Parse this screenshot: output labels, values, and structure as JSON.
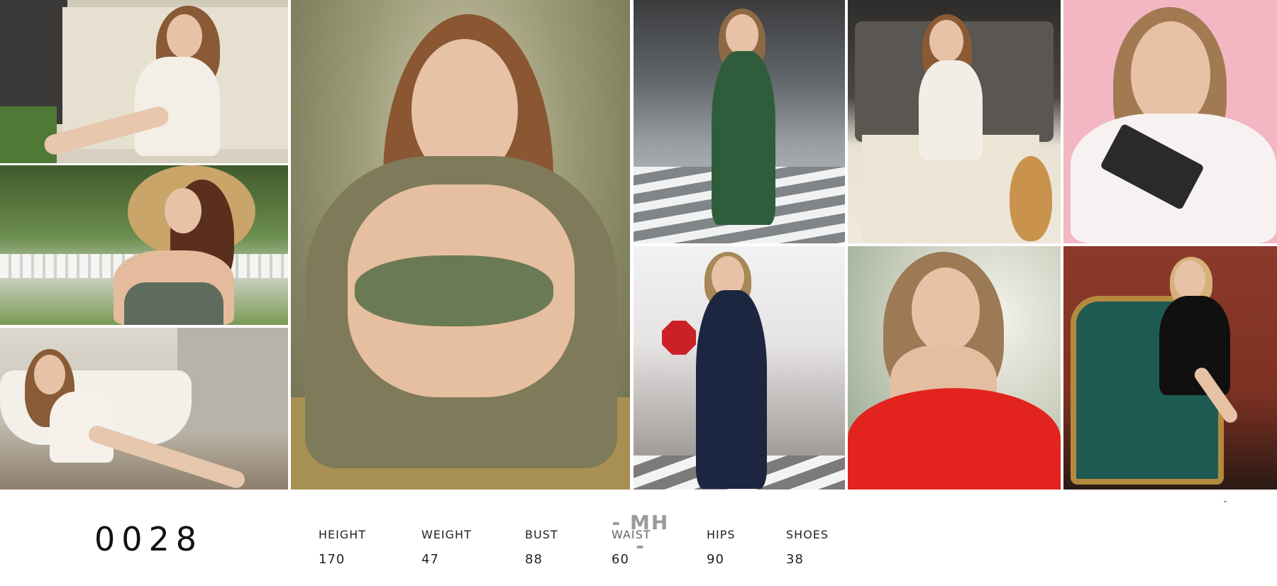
{
  "brand_mark": "- MH -",
  "model_id": "0028",
  "stats": [
    {
      "label": "HEIGHT",
      "value": "170"
    },
    {
      "label": "WEIGHT",
      "value": "47"
    },
    {
      "label": "BUST",
      "value": "88"
    },
    {
      "label": "WAIST",
      "value": "60"
    },
    {
      "label": "HIPS",
      "value": "90"
    },
    {
      "label": "SHOES",
      "value": "38"
    }
  ],
  "photos": [
    {
      "name": "photo-white-lingerie-by-car",
      "bg": "#d8d3c6"
    },
    {
      "name": "photo-straw-hat-garden",
      "bg": "#6f8a52"
    },
    {
      "name": "photo-white-bathtub",
      "bg": "#cfcac2"
    },
    {
      "name": "photo-green-bikini-feature",
      "bg": "#7d7a58"
    },
    {
      "name": "photo-floral-dress-street",
      "bg": "#8f9497"
    },
    {
      "name": "photo-car-trunk-guitar",
      "bg": "#d9d2c4"
    },
    {
      "name": "photo-pink-backdrop-wallet",
      "bg": "#f2b7c3"
    },
    {
      "name": "photo-sunglasses-stop-sign",
      "bg": "#a9a7a6"
    },
    {
      "name": "photo-red-dress",
      "bg": "#c9cdb8"
    },
    {
      "name": "photo-green-leather-chair",
      "bg": "#8b3a2c"
    }
  ]
}
